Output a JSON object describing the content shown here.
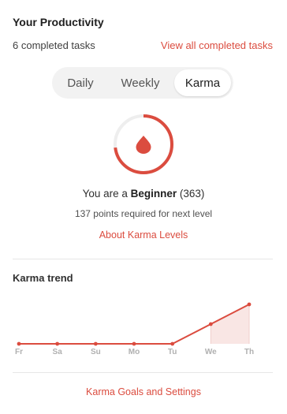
{
  "header": {
    "title": "Your Productivity",
    "completed_count": "6 completed tasks",
    "view_all_link": "View all completed tasks"
  },
  "tabs": [
    {
      "label": "Daily",
      "active": false
    },
    {
      "label": "Weekly",
      "active": false
    },
    {
      "label": "Karma",
      "active": true
    }
  ],
  "karma": {
    "prefix": "You are a ",
    "level": "Beginner",
    "score_text": " (363)",
    "progress_fraction": 0.73,
    "points_required": "137 points required for next level",
    "about_link": "About Karma Levels"
  },
  "trend": {
    "title": "Karma trend"
  },
  "footer": {
    "goals_link": "Karma Goals and Settings"
  },
  "colors": {
    "accent": "#db4c3f",
    "gauge_track": "#eeeeee",
    "fill": "#f9e6e4"
  },
  "chart_data": {
    "type": "area",
    "x": [
      "Fr",
      "Sa",
      "Su",
      "Mo",
      "Tu",
      "We",
      "Th"
    ],
    "series": [
      {
        "values": [
          0,
          0,
          0,
          0,
          0,
          1,
          2
        ]
      }
    ],
    "highlight_range": [
      "We",
      "Th"
    ],
    "grid": false,
    "legend": "none"
  }
}
